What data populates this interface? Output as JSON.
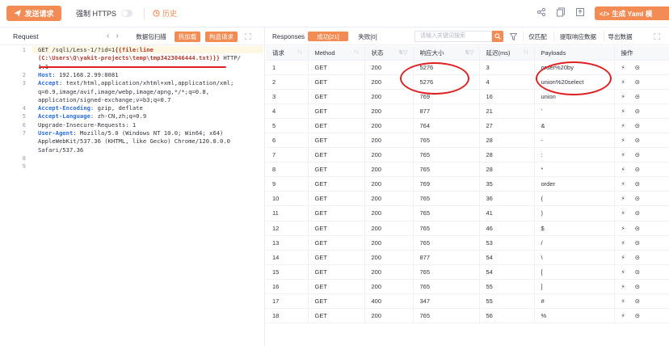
{
  "toolbar": {
    "send_label": "发送请求",
    "https_label": "强制 HTTPS",
    "history_label": "历史",
    "yaml_label": "生成 Yaml 模"
  },
  "request": {
    "title": "Request",
    "nav_prev": "‹",
    "nav_next": "›",
    "data_packet_btn": "数据包扫描",
    "hot_load_btn": "热加载",
    "build_request_btn": "构造请求",
    "lines": [
      {
        "n": "1",
        "parts": [
          {
            "t": "GET /sqli/Less-1/?id=1",
            "c": "hdr0"
          },
          {
            "t": "{{file:line",
            "c": "tpl"
          }
        ]
      },
      {
        "n": "",
        "parts": [
          {
            "t": "(C:\\Users\\Q\\yakit-projects\\temp\\tmp3423046444.txt)}}",
            "c": "tpl"
          },
          {
            "t": " HTTP/",
            "c": ""
          }
        ]
      },
      {
        "n": "",
        "parts": [
          {
            "t": "1.1",
            "c": ""
          }
        ]
      },
      {
        "n": "2",
        "parts": [
          {
            "t": "Host",
            "c": "hdr"
          },
          {
            "t": ": 192.168.2.99:8081",
            "c": ""
          }
        ]
      },
      {
        "n": "3",
        "parts": [
          {
            "t": "Accept",
            "c": "hdr"
          },
          {
            "t": ": text/html,application/xhtml+xml,application/xml;",
            "c": ""
          }
        ]
      },
      {
        "n": "",
        "parts": [
          {
            "t": "q=0.9,image/avif,image/webp,image/apng,*/*;q=0.8,",
            "c": ""
          }
        ]
      },
      {
        "n": "",
        "parts": [
          {
            "t": "application/signed-exchange;v=b3;q=0.7",
            "c": ""
          }
        ]
      },
      {
        "n": "4",
        "parts": [
          {
            "t": "Accept-Encoding",
            "c": "hdr"
          },
          {
            "t": ": gzip, deflate",
            "c": ""
          }
        ]
      },
      {
        "n": "5",
        "parts": [
          {
            "t": "Accept-Language",
            "c": "hdr"
          },
          {
            "t": ": zh-CN,zh;q=0.9",
            "c": ""
          }
        ]
      },
      {
        "n": "6",
        "parts": [
          {
            "t": "Upgrade-Insecure-Requests: 1",
            "c": ""
          }
        ]
      },
      {
        "n": "7",
        "parts": [
          {
            "t": "User-Agent",
            "c": "hdr"
          },
          {
            "t": ": Mozilla/5.0 (Windows NT 10.0; Win64; x64)",
            "c": ""
          }
        ]
      },
      {
        "n": "",
        "parts": [
          {
            "t": "AppleWebKit/537.36 (KHTML, like Gecko) Chrome/120.0.0.0",
            "c": ""
          }
        ]
      },
      {
        "n": "",
        "parts": [
          {
            "t": "Safari/537.36",
            "c": ""
          }
        ]
      },
      {
        "n": "8",
        "parts": []
      },
      {
        "n": "9",
        "parts": []
      }
    ]
  },
  "responses": {
    "title": "Responses",
    "tab_success": "成功[21]",
    "tab_fail": "失败[0]",
    "search_placeholder": "请输入关键词搜索",
    "copy_btn": "仅匹配",
    "extract_btn": "提取响应数据",
    "export_btn": "导出数据",
    "columns": [
      "请求",
      "Method",
      "状态",
      "响应大小",
      "延迟(ms)",
      "Payloads",
      "操作"
    ],
    "rows": [
      {
        "id": "1",
        "method": "GET",
        "status": "200",
        "size": "5276",
        "delay": "3",
        "payload": "order%20by"
      },
      {
        "id": "2",
        "method": "GET",
        "status": "200",
        "size": "5276",
        "delay": "4",
        "payload": "union%20select"
      },
      {
        "id": "3",
        "method": "GET",
        "status": "200",
        "size": "769",
        "delay": "16",
        "payload": "union"
      },
      {
        "id": "4",
        "method": "GET",
        "status": "200",
        "size": "877",
        "delay": "21",
        "payload": "'"
      },
      {
        "id": "5",
        "method": "GET",
        "status": "200",
        "size": "764",
        "delay": "27",
        "payload": "&"
      },
      {
        "id": "6",
        "method": "GET",
        "status": "200",
        "size": "765",
        "delay": "28",
        "payload": "-"
      },
      {
        "id": "7",
        "method": "GET",
        "status": "200",
        "size": "765",
        "delay": "28",
        "payload": ":"
      },
      {
        "id": "8",
        "method": "GET",
        "status": "200",
        "size": "765",
        "delay": "28",
        "payload": "*"
      },
      {
        "id": "9",
        "method": "GET",
        "status": "200",
        "size": "769",
        "delay": "35",
        "payload": "order"
      },
      {
        "id": "10",
        "method": "GET",
        "status": "200",
        "size": "765",
        "delay": "36",
        "payload": "("
      },
      {
        "id": "11",
        "method": "GET",
        "status": "200",
        "size": "765",
        "delay": "41",
        "payload": ")"
      },
      {
        "id": "12",
        "method": "GET",
        "status": "200",
        "size": "765",
        "delay": "46",
        "payload": "$"
      },
      {
        "id": "13",
        "method": "GET",
        "status": "200",
        "size": "765",
        "delay": "53",
        "payload": "/"
      },
      {
        "id": "14",
        "method": "GET",
        "status": "200",
        "size": "877",
        "delay": "54",
        "payload": "\\"
      },
      {
        "id": "15",
        "method": "GET",
        "status": "200",
        "size": "765",
        "delay": "54",
        "payload": "["
      },
      {
        "id": "16",
        "method": "GET",
        "status": "200",
        "size": "765",
        "delay": "55",
        "payload": "]"
      },
      {
        "id": "17",
        "method": "GET",
        "status": "400",
        "size": "347",
        "delay": "55",
        "payload": "#"
      },
      {
        "id": "18",
        "method": "GET",
        "status": "200",
        "size": "765",
        "delay": "56",
        "payload": "%"
      }
    ]
  },
  "colors": {
    "accent": "#f28b54",
    "success": "#4cb944",
    "error": "#e0433a",
    "annotation": "#e02020",
    "header_key": "#2a6fdb"
  },
  "icons": [
    "paper-plane-icon",
    "clock-icon",
    "share-icon",
    "copy-icon",
    "export-icon",
    "code-icon",
    "chevron-left-icon",
    "chevron-right-icon",
    "expand-icon",
    "search-icon",
    "filter-icon",
    "sort-icon",
    "flash-icon",
    "arrow-right-circle-icon"
  ]
}
